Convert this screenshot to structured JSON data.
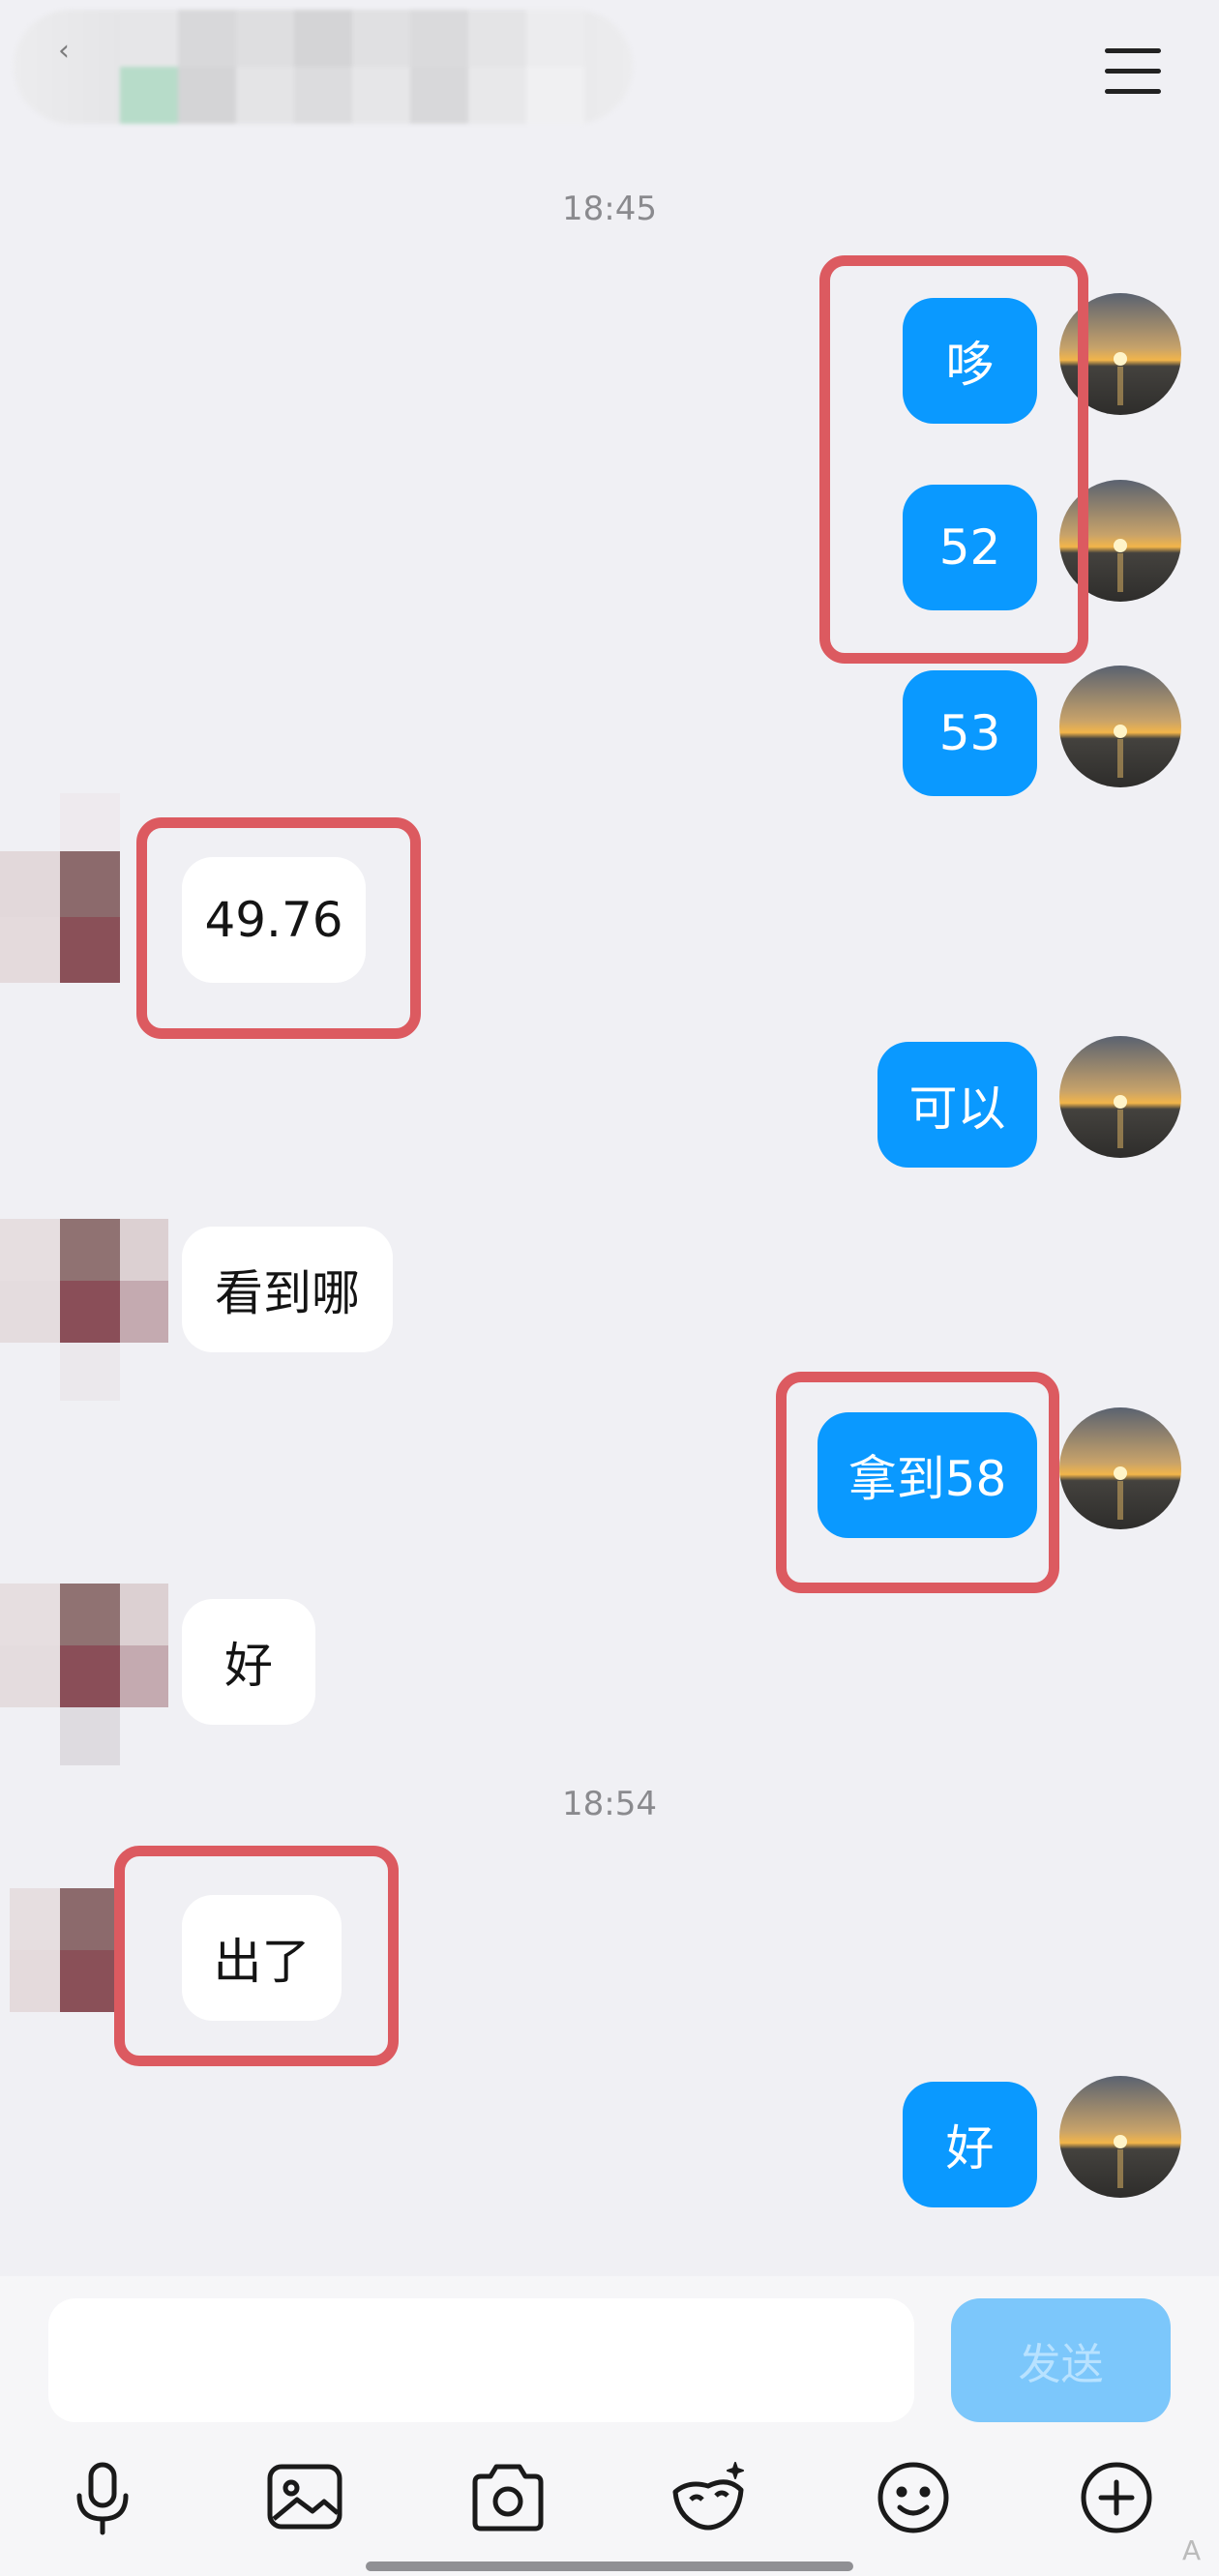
{
  "header": {
    "title": ""
  },
  "messages": [
    {
      "type": "timestamp",
      "text": "18:45"
    },
    {
      "type": "out",
      "text": "哆"
    },
    {
      "type": "out",
      "text": "52"
    },
    {
      "type": "out",
      "text": "53"
    },
    {
      "type": "in",
      "text": "49.76"
    },
    {
      "type": "out",
      "text": "可以"
    },
    {
      "type": "in",
      "text": "看到哪"
    },
    {
      "type": "out",
      "text": "拿到58"
    },
    {
      "type": "in",
      "text": "好"
    },
    {
      "type": "timestamp",
      "text": "18:54"
    },
    {
      "type": "in",
      "text": "出了"
    },
    {
      "type": "out",
      "text": "好"
    }
  ],
  "composer": {
    "input_value": "",
    "send_label": "发送"
  },
  "toolbar": {
    "icons": [
      "microphone-icon",
      "image-icon",
      "camera-icon",
      "mask-icon",
      "emoji-icon",
      "plus-icon"
    ]
  },
  "colors": {
    "outgoing_bubble": "#0a99ff",
    "incoming_bubble": "#ffffff",
    "highlight_border": "#dc5a60",
    "send_button": "#7cc7fb",
    "background": "#f0f0f4"
  },
  "corner_mark": "A"
}
